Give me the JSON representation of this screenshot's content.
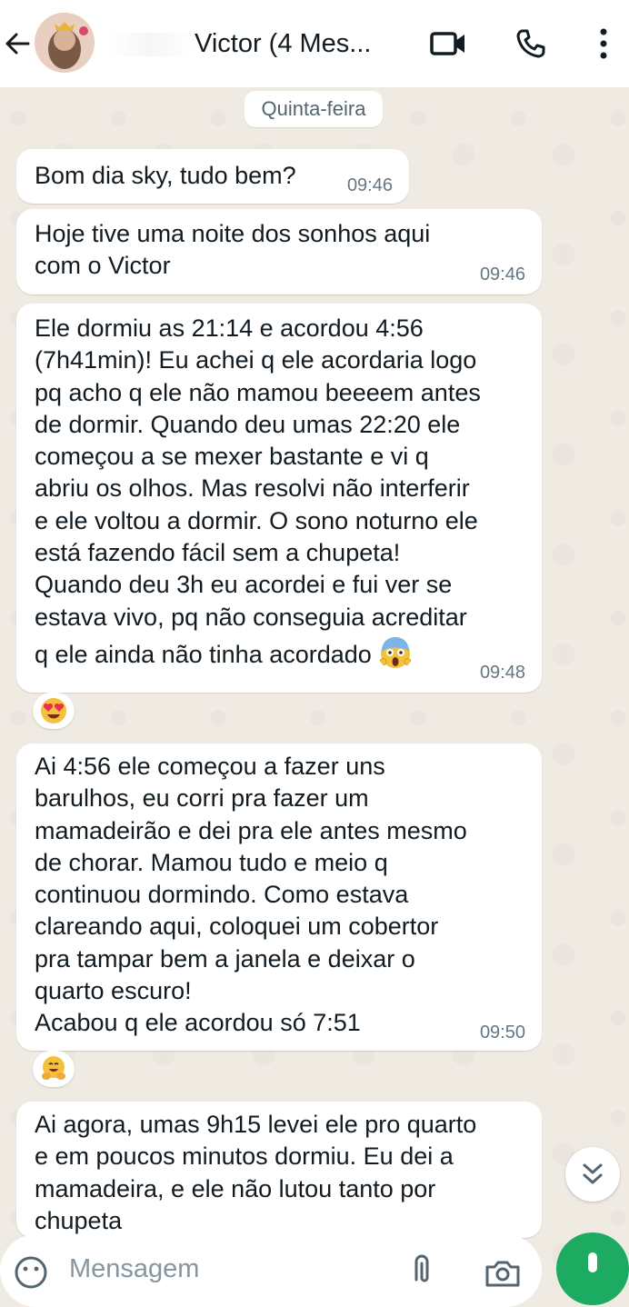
{
  "header": {
    "title": "Victor (4 Mes...",
    "icons": {
      "back": "arrow-left",
      "video": "video-camera",
      "call": "phone",
      "menu": "vertical-ellipsis"
    }
  },
  "date_separator": "Quinta-feira",
  "messages": [
    {
      "text": "Bom dia sky, tudo bem?",
      "time": "09:46"
    },
    {
      "text": "Hoje tive uma noite dos sonhos aqui\ncom o Victor",
      "time": "09:46"
    },
    {
      "text": "Ele dormiu as 21:14 e acordou 4:56\n(7h41min)! Eu achei q ele acordaria logo\npq acho q ele não mamou beeeem antes\nde dormir. Quando deu umas 22:20 ele\ncomeçou a se mexer bastante e vi q\nabriu os olhos. Mas resolvi não interferir\ne ele voltou a dormir. O sono noturno ele\nestá fazendo fácil sem a chupeta!\nQuando deu 3h eu acordei e fui ver se\nestava vivo, pq não conseguia acreditar\nq ele ainda não tinha acordado",
      "time": "09:48",
      "trailing_emoji": "face-screaming-in-fear",
      "reaction": "heart-eyes"
    },
    {
      "text": "Ai 4:56 ele começou a fazer uns\nbarulhos, eu corri pra fazer um\nmamadeirão e dei pra ele antes mesmo\nde chorar. Mamou tudo e meio q\ncontinuou dormindo. Como estava\nclareando aqui, coloquei um cobertor\npra tampar bem a janela e deixar o\nquarto escuro!\nAcabou q ele acordou só 7:51",
      "time": "09:50",
      "reaction": "hugging-face"
    },
    {
      "text": "Ai agora, umas 9h15 levei ele pro quarto\ne em poucos minutos dormiu. Eu dei a\nmamadeira, e ele não lutou tanto por\nchupeta"
    }
  ],
  "composer": {
    "placeholder": "Mensagem",
    "icons": {
      "emoji": "smiley-icon",
      "attach": "paperclip-icon",
      "camera": "camera-icon",
      "mic": "mic-icon"
    }
  },
  "colors": {
    "accent": "#1daa61",
    "bubble": "#ffffff",
    "background": "#efeae2",
    "time": "#667781"
  }
}
